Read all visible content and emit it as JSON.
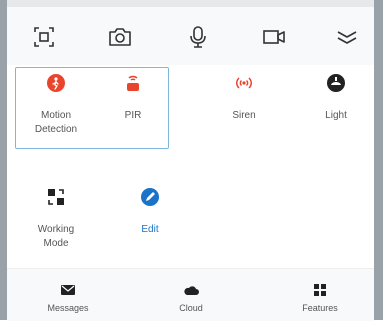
{
  "toolbar": {
    "icons": [
      "screenshot-icon",
      "camera-icon",
      "microphone-icon",
      "video-icon",
      "collapse-icon"
    ]
  },
  "controls": {
    "motion_detection": {
      "label": "Motion\nDetection",
      "icon": "motion-detection-icon",
      "color": "#e8452c"
    },
    "pir": {
      "label": "PIR",
      "icon": "pir-sensor-icon",
      "color": "#e8452c"
    },
    "siren": {
      "label": "Siren",
      "icon": "siren-icon",
      "color": "#e8452c"
    },
    "light": {
      "label": "Light",
      "icon": "light-icon",
      "color": "#222222"
    },
    "working_mode": {
      "label": "Working\nMode",
      "icon": "working-mode-icon",
      "color": "#222222"
    },
    "edit": {
      "label": "Edit",
      "icon": "edit-icon",
      "color": "#1a73c8"
    }
  },
  "bottom_nav": [
    {
      "label": "Messages",
      "icon": "messages-icon"
    },
    {
      "label": "Cloud",
      "icon": "cloud-icon"
    },
    {
      "label": "Features",
      "icon": "features-icon"
    }
  ]
}
